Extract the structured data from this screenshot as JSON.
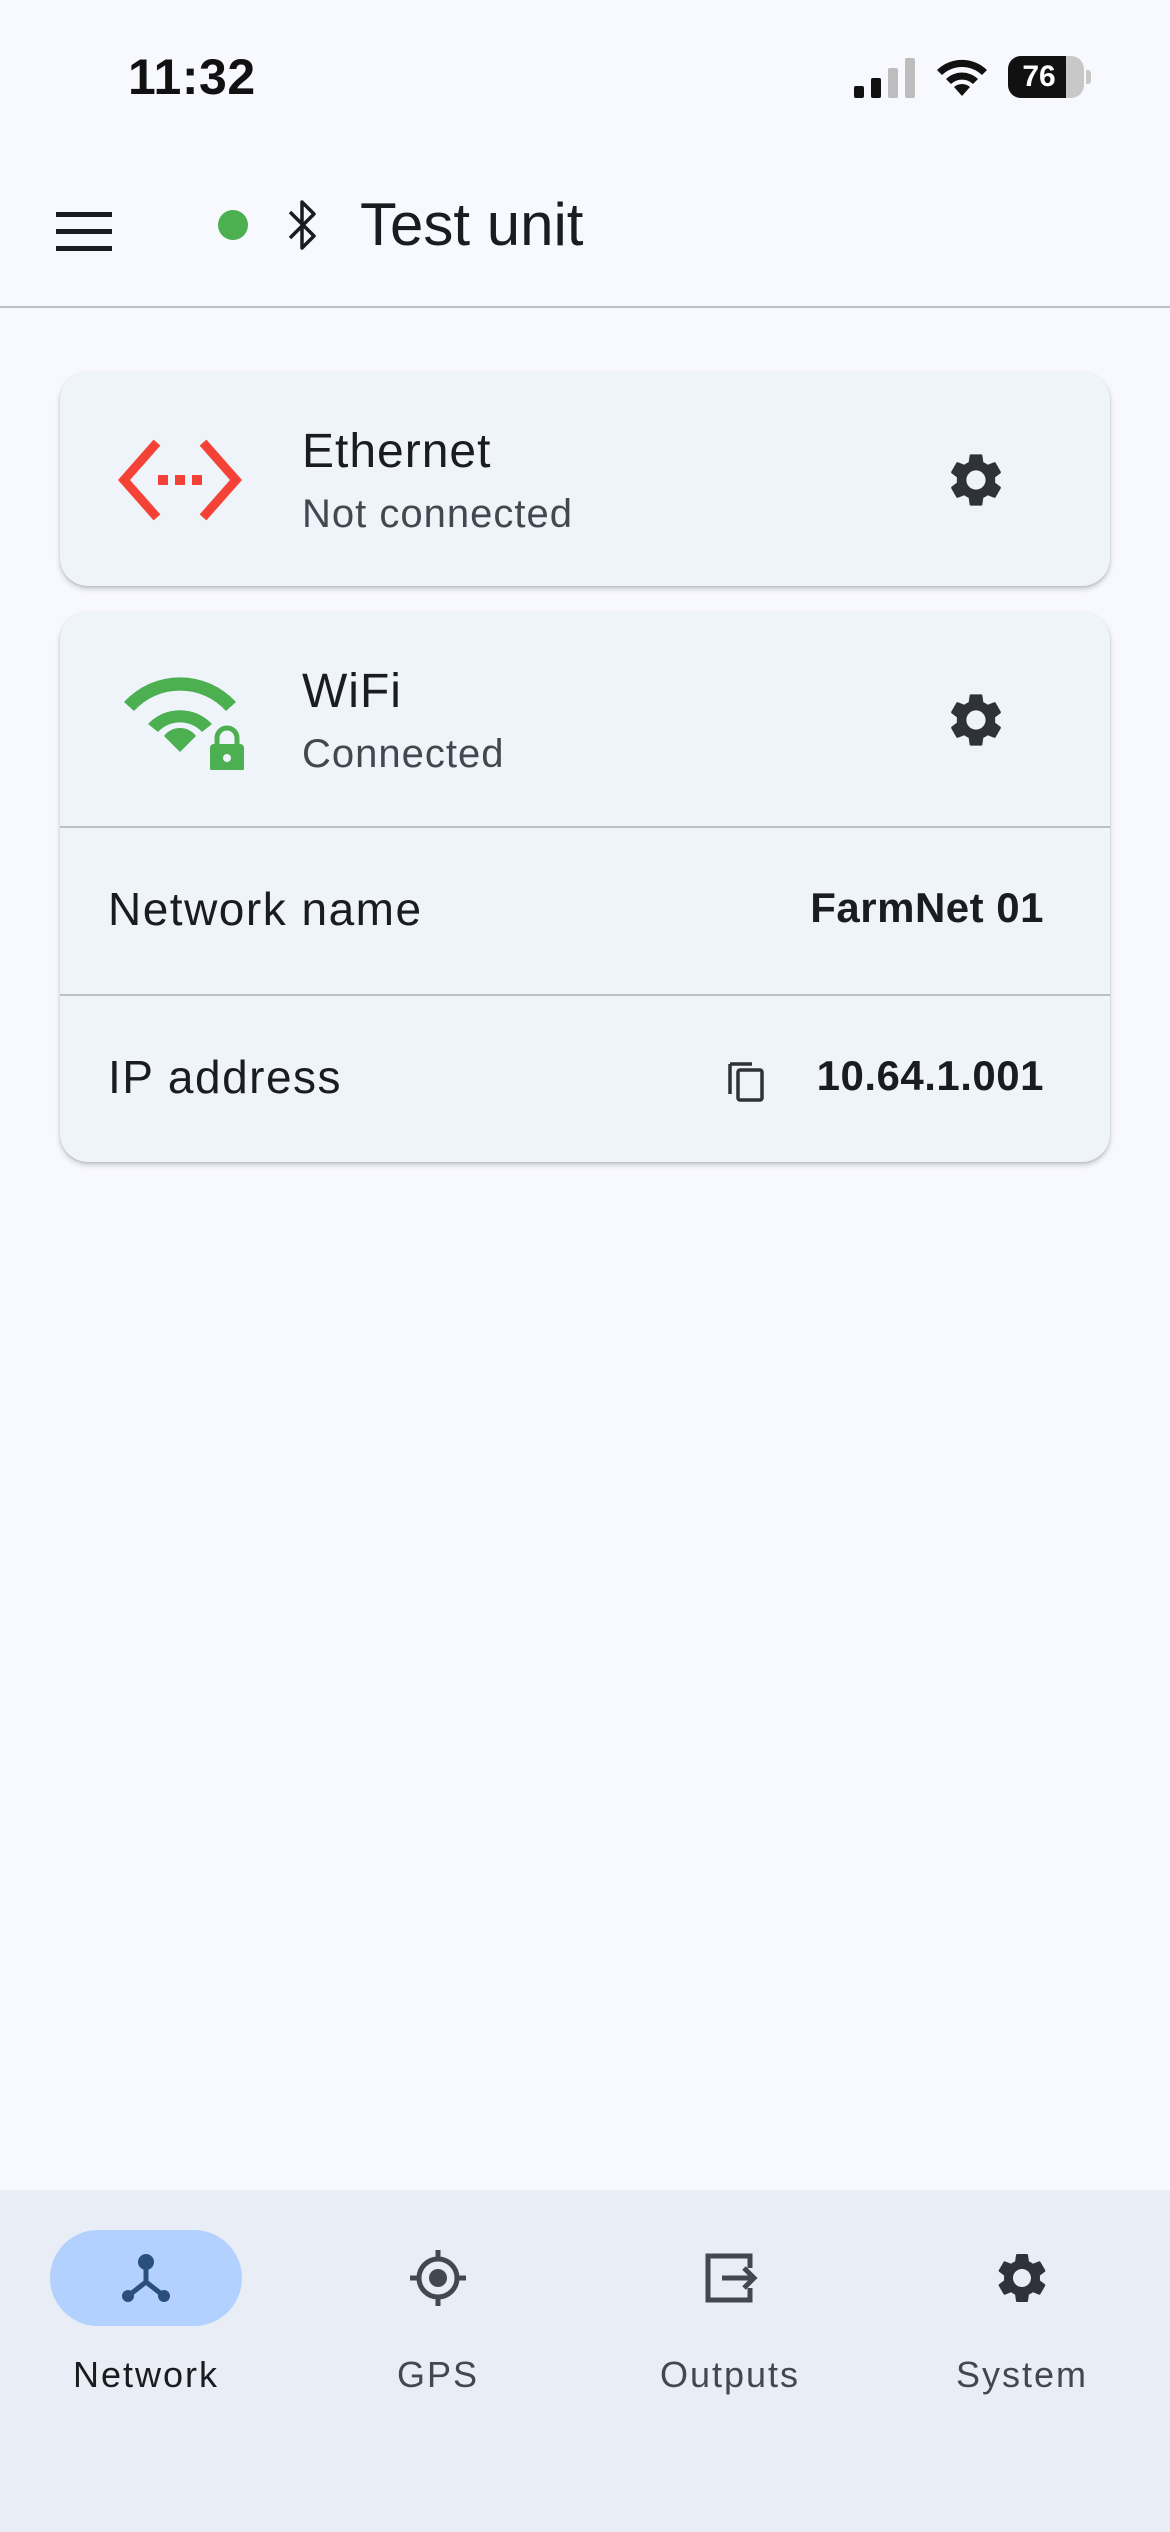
{
  "status_bar": {
    "time": "11:32",
    "battery_percent": 76,
    "battery_label": "76",
    "signal_bars": 2
  },
  "app_bar": {
    "title": "Test unit",
    "connection_color": "#4caf50",
    "icons": [
      "menu-icon",
      "bluetooth-icon"
    ]
  },
  "cards": {
    "ethernet": {
      "title": "Ethernet",
      "status": "Not connected",
      "icon": "ethernet-icon",
      "icon_color": "#f44336"
    },
    "wifi": {
      "title": "WiFi",
      "status": "Connected",
      "icon": "wifi-lock-icon",
      "icon_color": "#4caf50",
      "rows": [
        {
          "label": "Network name",
          "value": "FarmNet 01"
        },
        {
          "label": "IP address",
          "value": "10.64.1.001"
        }
      ]
    }
  },
  "bottom_nav": {
    "items": [
      {
        "label": "Network",
        "icon": "network-icon",
        "active": true
      },
      {
        "label": "GPS",
        "icon": "gps-icon",
        "active": false
      },
      {
        "label": "Outputs",
        "icon": "outputs-icon",
        "active": false
      },
      {
        "label": "System",
        "icon": "settings-icon",
        "active": false
      }
    ],
    "active_color": "#b3d1ff"
  }
}
